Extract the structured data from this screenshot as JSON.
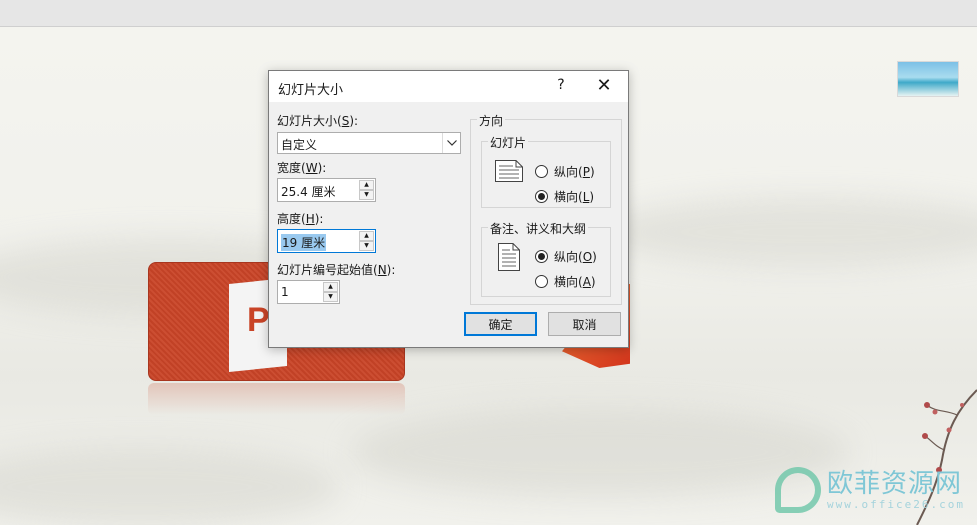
{
  "dialog": {
    "title": "幻灯片大小",
    "help_label": "?",
    "close_label": "✕",
    "slide_size": {
      "label_prefix": "幻灯片大小(",
      "label_key": "S",
      "label_suffix": "):",
      "value": "自定义"
    },
    "width": {
      "label_prefix": "宽度(",
      "label_key": "W",
      "label_suffix": "):",
      "value": "25.4 厘米"
    },
    "height": {
      "label_prefix": "高度(",
      "label_key": "H",
      "label_suffix": "):",
      "value": "19 厘米"
    },
    "numbering": {
      "label_prefix": "幻灯片编号起始值(",
      "label_key": "N",
      "label_suffix": "):",
      "value": "1"
    },
    "orientation": {
      "title": "方向",
      "slides": {
        "title": "幻灯片",
        "portrait_prefix": "纵向(",
        "portrait_key": "P",
        "portrait_suffix": ")",
        "landscape_prefix": "横向(",
        "landscape_key": "L",
        "landscape_suffix": ")",
        "selected": "landscape"
      },
      "notes": {
        "title": "备注、讲义和大纲",
        "portrait_prefix": "纵向(",
        "portrait_key": "O",
        "portrait_suffix": ")",
        "landscape_prefix": "横向(",
        "landscape_key": "A",
        "landscape_suffix": ")",
        "selected": "portrait"
      }
    },
    "ok_label": "确定",
    "cancel_label": "取消"
  },
  "watermark": {
    "title": "欧菲资源网",
    "subtitle": "www.office26.com"
  },
  "slide": {
    "logo_letter": "P"
  },
  "colors": {
    "accent": "#0078d7",
    "ppt_red": "#c94427"
  }
}
